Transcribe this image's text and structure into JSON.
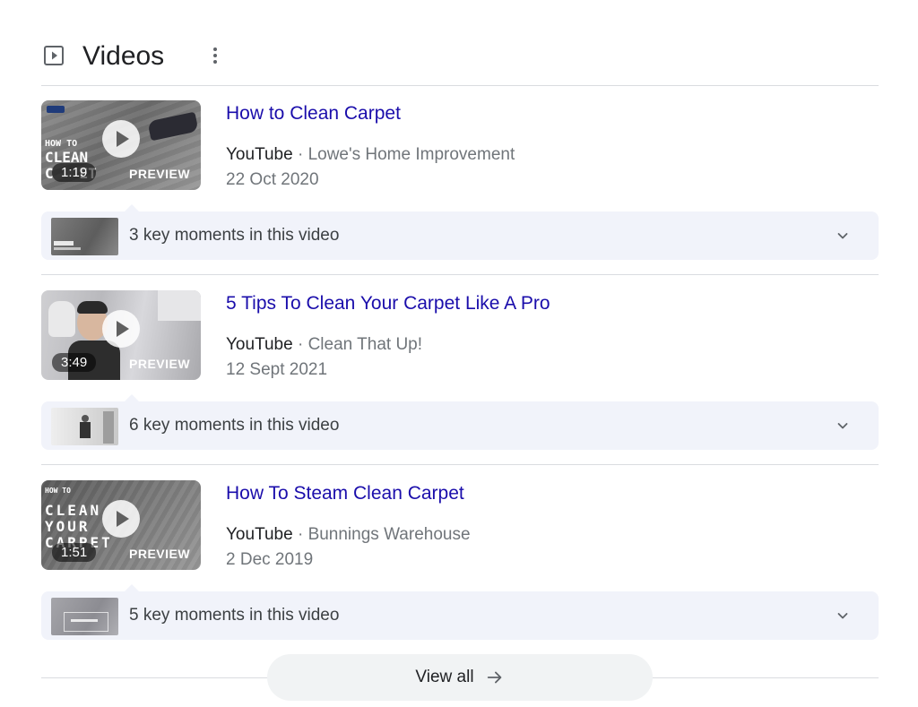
{
  "header": {
    "title": "Videos",
    "icon": "play-square-icon",
    "more_icon": "more-vert-icon"
  },
  "videos": [
    {
      "title": "How to Clean Carpet",
      "source": "YouTube",
      "separator": "·",
      "channel": "Lowe's Home Improvement",
      "date": "22 Oct 2020",
      "duration": "1:19",
      "preview": "PREVIEW",
      "key_moments": "3 key moments in this video"
    },
    {
      "title": "5 Tips To Clean Your Carpet Like A Pro",
      "source": "YouTube",
      "separator": "·",
      "channel": "Clean That Up!",
      "date": "12 Sept 2021",
      "duration": "3:49",
      "preview": "PREVIEW",
      "key_moments": "6 key moments in this video"
    },
    {
      "title": "How To Steam Clean Carpet",
      "source": "YouTube",
      "separator": "·",
      "channel": "Bunnings Warehouse",
      "date": "2 Dec 2019",
      "duration": "1:51",
      "preview": "PREVIEW",
      "key_moments": "5 key moments in this video"
    }
  ],
  "view_all": {
    "label": "View all",
    "icon": "arrow-right-icon"
  },
  "colors": {
    "link": "#1a0dab",
    "secondary_text": "#70757a",
    "key_moments_bg": "#f1f3fa",
    "view_all_bg": "#f1f3f4"
  }
}
